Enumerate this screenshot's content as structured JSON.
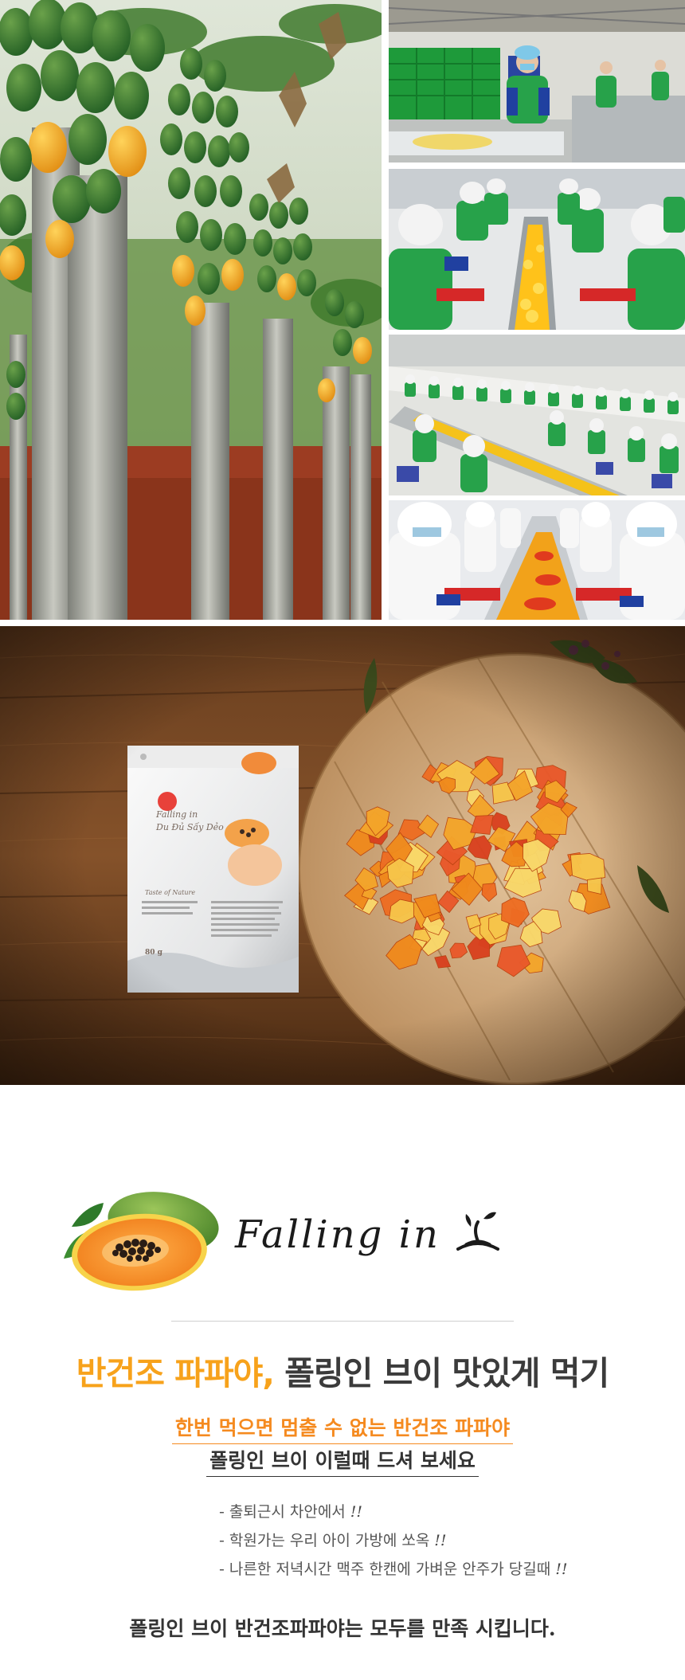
{
  "pouch": {
    "brand_line": "Falling in",
    "product_line": "Du Đủ Sấy Dẻo",
    "tagline": "Taste of Nature",
    "weight": "80 g"
  },
  "section": {
    "script_title": "Falling in",
    "headline_highlight": "반건조 파파야,",
    "headline_rest": " 폴링인 브이 맛있게 먹기",
    "sub_orange": "한번 먹으면 멈출 수 없는 반건조 파파야",
    "sub_dark": "폴링인 브이 이럴때 드셔 보세요",
    "bullets": [
      {
        "text": "- 출퇴근시 차안에서",
        "mark": "!!"
      },
      {
        "text": "- 학원가는 우리 아이 가방에 쏘옥",
        "mark": "!!"
      },
      {
        "text": "- 나른한 저녁시간 맥주 한캔에 가벼운 안주가 당길때",
        "mark": "!!"
      }
    ],
    "closing": "폴링인 브이 반건조파파야는 모두를 만족 시킵니다."
  },
  "colors": {
    "orange_text": "#f58a1f",
    "headline_orange": "#f7a21b",
    "dark_text": "#333333"
  }
}
